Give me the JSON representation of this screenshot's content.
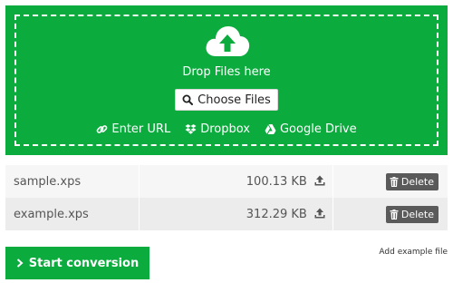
{
  "dropzone": {
    "upload_icon": "cloud-upload-icon",
    "drop_text": "Drop Files here",
    "choose_files_label": "Choose Files",
    "sources": [
      {
        "label": "Enter URL",
        "icon": "link-icon"
      },
      {
        "label": "Dropbox",
        "icon": "dropbox-icon"
      },
      {
        "label": "Google Drive",
        "icon": "google-drive-icon"
      }
    ]
  },
  "files": [
    {
      "name": "sample.xps",
      "size": "100.13 KB",
      "delete_label": "Delete"
    },
    {
      "name": "example.xps",
      "size": "312.29 KB",
      "delete_label": "Delete"
    }
  ],
  "start_conversion_label": "Start conversion",
  "add_example_label": "Add example file",
  "colors": {
    "accent": "#0bab3e",
    "delete_bg": "#5a5a5a"
  }
}
